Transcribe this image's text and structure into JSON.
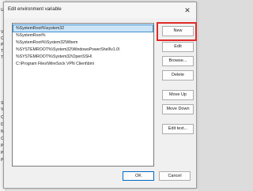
{
  "background": {
    "letters": [
      "Us",
      "Va",
      "O",
      "P",
      "TE",
      "TN",
      "Sy",
      "Va",
      "Co",
      "Dr",
      "NU",
      "OS",
      "Pa",
      "PA",
      "PR"
    ]
  },
  "dialog": {
    "title": "Edit environment variable",
    "close_glyph": "✕"
  },
  "path_list": {
    "items": [
      "%SystemRoot%\\system32",
      "%SystemRoot%",
      "%SystemRoot%\\System32\\Wbem",
      "%SYSTEMROOT%\\System32\\WindowsPowerShell\\v1.0\\",
      "%SYSTEMROOT%\\System32\\OpenSSH\\",
      "C:\\Program Files\\WireSock VPN Client\\bin\\"
    ],
    "selected_index": 0
  },
  "buttons": {
    "new": "New",
    "edit": "Edit",
    "browse": "Browse...",
    "delete": "Delete",
    "move_up": "Move Up",
    "move_down": "Move Down",
    "edit_text": "Edit text..."
  },
  "footer": {
    "ok": "OK",
    "cancel": "Cancel"
  },
  "colors": {
    "selection": "#cce4f7",
    "highlight_box": "#e12a2a"
  }
}
